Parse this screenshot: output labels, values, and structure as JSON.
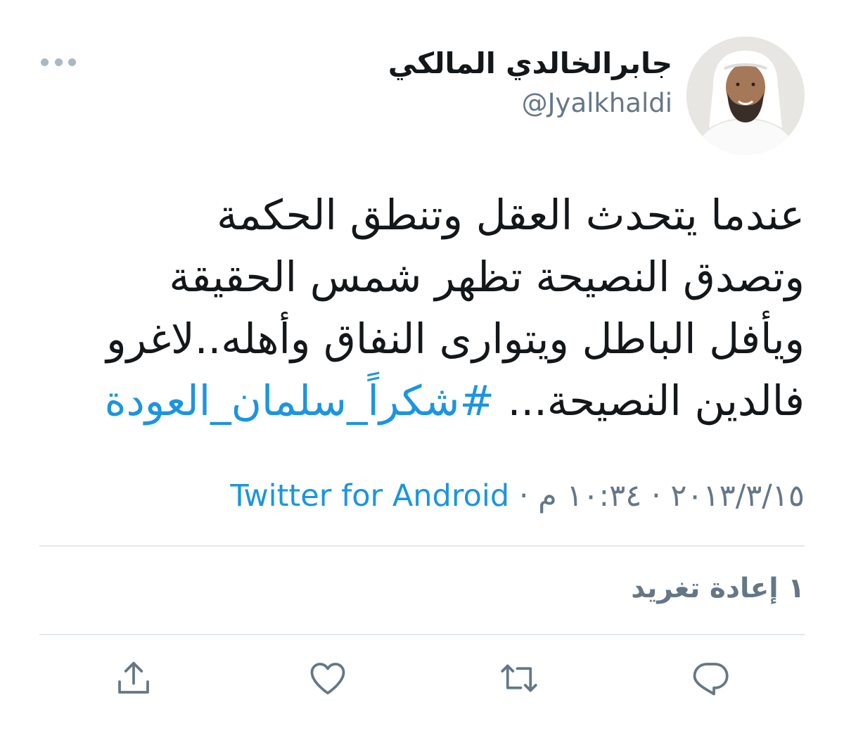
{
  "tweet": {
    "author": {
      "display_name": "جابرالخالدي المالكي",
      "handle": "@Jyalkhaldi",
      "avatar_icon": "profile-photo"
    },
    "text_lines": [
      "عندما يتحدث العقل وتنطق الحكمة",
      "وتصدق النصيحة تظهر شمس الحقيقة",
      "ويأفل الباطل ويتوارى النفاق وأهله..لاغرو",
      "فالدين النصيحة..."
    ],
    "hashtag": "#شكراً_سلمان_العودة",
    "date": "٢٠١٣/٣/١٥",
    "separator": "·",
    "time": "١٠:٣٤ م",
    "source": "Twitter for Android",
    "retweet_count": "١",
    "retweet_label": "إعادة تغريد"
  },
  "actions": {
    "reply_icon": "reply-icon",
    "retweet_icon": "retweet-icon",
    "like_icon": "heart-icon",
    "share_icon": "share-icon"
  },
  "colors": {
    "link": "#1b95e0",
    "text": "#14171a",
    "secondary": "#657786",
    "divider": "#e1e8ed"
  }
}
